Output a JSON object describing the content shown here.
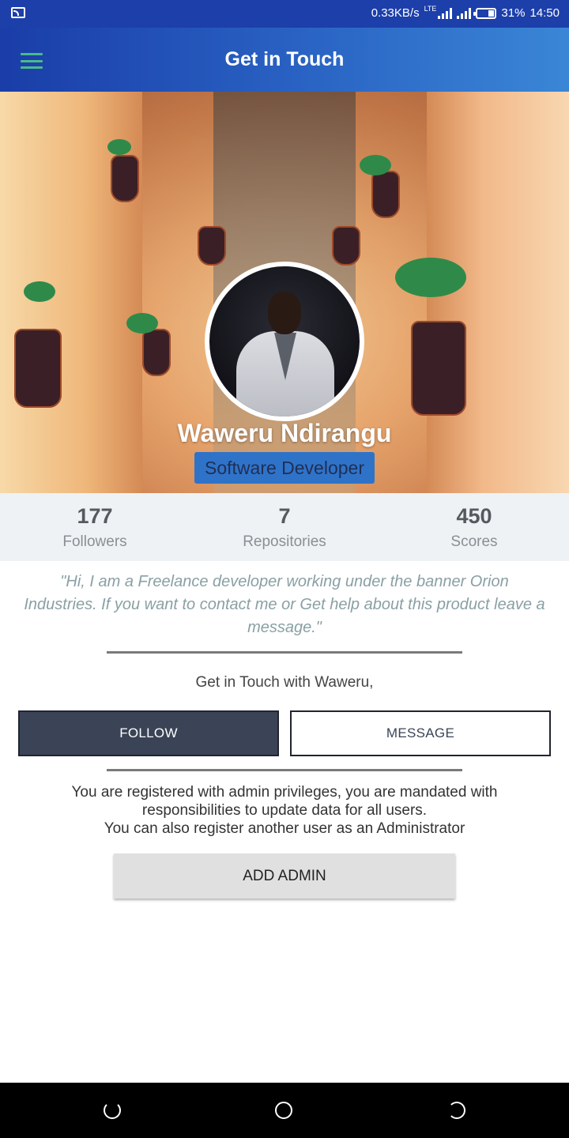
{
  "status_bar": {
    "net_speed": "0.33KB/s",
    "net_type": "LTE",
    "battery": "31%",
    "time": "14:50"
  },
  "app_bar": {
    "title": "Get in Touch",
    "menu_icon": "hamburger-icon"
  },
  "profile": {
    "name": "Waweru Ndirangu",
    "role": "Software Developer"
  },
  "stats": [
    {
      "value": "177",
      "label": "Followers"
    },
    {
      "value": "7",
      "label": "Repositories"
    },
    {
      "value": "450",
      "label": "Scores"
    }
  ],
  "quote": "\"Hi, I am a Freelance developer working under the banner Orion Industries. If you want to contact me or Get help about this product leave a message.\"",
  "get_in_touch": "Get in Touch with Waweru,",
  "buttons": {
    "follow": "FOLLOW",
    "message": "MESSAGE",
    "add_admin": "ADD ADMIN"
  },
  "admin": {
    "line1": "You are registered with admin privileges, you are mandated with responsibilities to update data for all users.",
    "line2": "You can also register another user as an Administrator"
  },
  "colors": {
    "app_bar": "#1a3da8",
    "role_badge": "#2f73c9",
    "follow_button": "#3a4456"
  }
}
